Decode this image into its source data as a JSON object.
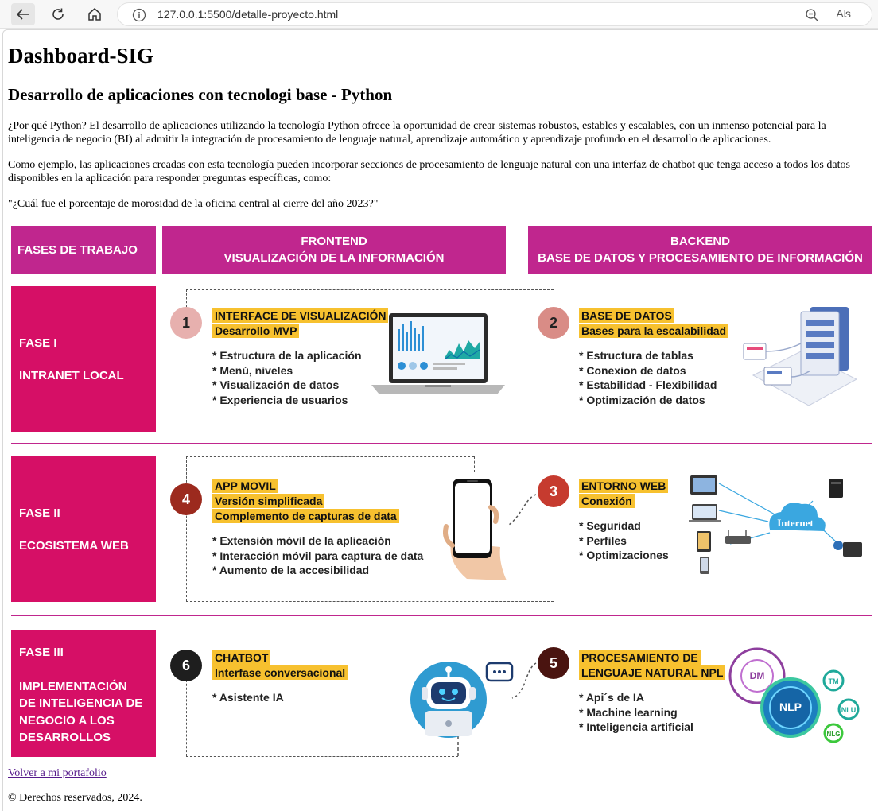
{
  "browser": {
    "url": "127.0.0.1:5500/detalle-proyecto.html",
    "read_aloud_label": "Aʪ"
  },
  "page": {
    "title": "Dashboard-SIG",
    "subtitle": "Desarrollo de aplicaciones con tecnologi base - Python",
    "paragraphs": [
      "¿Por qué Python? El desarrollo de aplicaciones utilizando la tecnología Python ofrece la oportunidad de crear sistemas robustos, estables y escalables, con un inmenso potencial para la inteligencia de negocio (BI) al admitir la integración de procesamiento de lenguaje natural, aprendizaje automático y aprendizaje profundo en el desarrollo de aplicaciones.",
      "Como ejemplo, las aplicaciones creadas con esta tecnología pueden incorporar secciones de procesamiento de lenguaje natural con una interfaz de chatbot que tenga acceso a todos los datos disponibles en la aplicación para responder preguntas específicas, como:",
      "\"¿Cuál fue el porcentaje de morosidad de la oficina central al cierre del año 2023?\""
    ],
    "back_link": "Volver a mi portafolio",
    "footer": "© Derechos reservados, 2024."
  },
  "infographic": {
    "header_fases": "FASES DE TRABAJO",
    "header_frontend": [
      "FRONTEND",
      "VISUALIZACIÓN DE LA INFORMACIÓN"
    ],
    "header_backend": [
      "BACKEND",
      "BASE DE DATOS Y PROCESAMIENTO DE INFORMACIÓN"
    ],
    "fases": [
      {
        "lines": [
          "FASE I",
          "INTRANET LOCAL"
        ]
      },
      {
        "lines": [
          "FASE II",
          "ECOSISTEMA WEB"
        ]
      },
      {
        "lines": [
          "FASE III",
          "IMPLEMENTACIÓN",
          "DE INTELIGENCIA DE",
          "NEGOCIO A LOS",
          "DESARROLLOS"
        ]
      }
    ],
    "steps": [
      {
        "num": "1",
        "title": [
          "INTERFACE DE VISUALIZACIÓN",
          "Desarrollo MVP"
        ],
        "bullets": [
          "* Estructura de la aplicación",
          "* Menú, niveles",
          "* Visualización de datos",
          "* Experiencia de usuarios"
        ],
        "color": "#e7b0ae"
      },
      {
        "num": "2",
        "title": [
          "BASE DE DATOS",
          "Bases para la escalabilidad"
        ],
        "bullets": [
          "* Estructura de tablas",
          "* Conexion de datos",
          "* Estabilidad - Flexibilidad",
          "* Optimización de datos"
        ],
        "color": "#d98c86"
      },
      {
        "num": "3",
        "title": [
          "ENTORNO WEB",
          "Conexión"
        ],
        "bullets": [
          "* Seguridad",
          "* Perfiles",
          "* Optimizaciones"
        ],
        "color": "#c63b2f"
      },
      {
        "num": "4",
        "title": [
          "APP MOVIL",
          "Versión simplificada",
          "Complemento de capturas de data"
        ],
        "bullets": [
          "* Extensión móvil de la aplicación",
          "* Interacción móvil para captura de data",
          "* Aumento de la accesibilidad"
        ],
        "color": "#9c2a1e"
      },
      {
        "num": "5",
        "title": [
          "PROCESAMIENTO DE",
          "LENGUAJE NATURAL NPL"
        ],
        "bullets": [
          "* Api´s de IA",
          "* Machine learning",
          "* Inteligencia artificial"
        ],
        "color": "#4a1410"
      },
      {
        "num": "6",
        "title": [
          "CHATBOT",
          "Interfase conversacional"
        ],
        "bullets": [
          "* Asistente IA"
        ],
        "color": "#1e1e1e"
      }
    ],
    "internet_label": "Internet",
    "nlp_labels": {
      "dm": "DM",
      "nlp": "NLP",
      "tm": "TM",
      "nlu": "NLU",
      "nlg": "NLG"
    }
  }
}
